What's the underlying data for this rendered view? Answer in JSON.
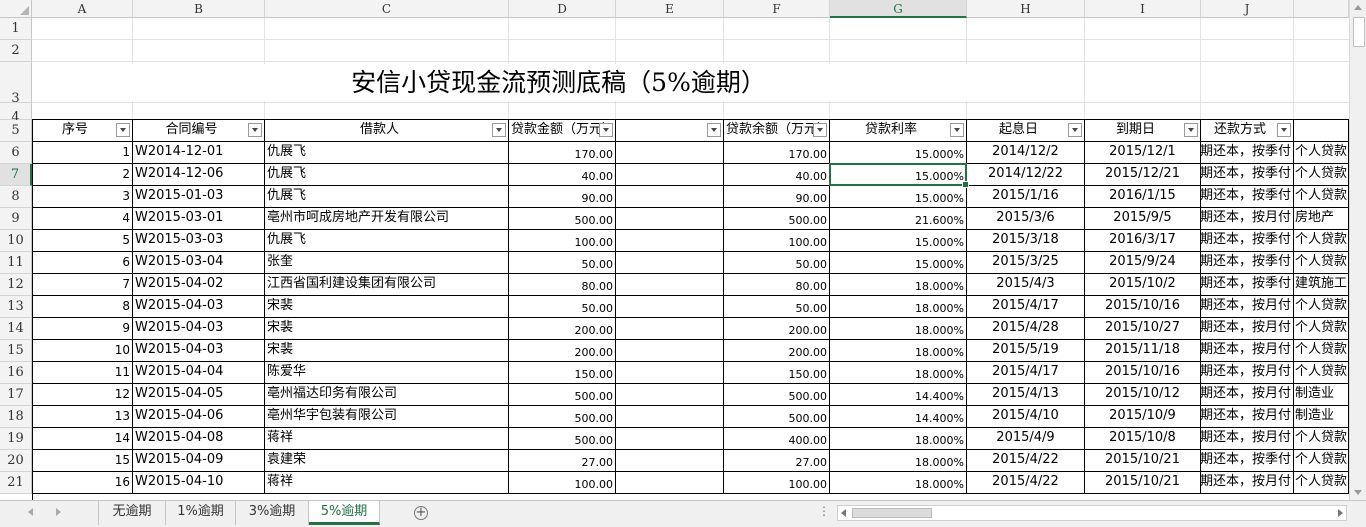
{
  "sheet": {
    "columns": [
      "A",
      "B",
      "C",
      "D",
      "E",
      "F",
      "G",
      "H",
      "I",
      "J"
    ],
    "selected_column": "G",
    "selected_row": 7,
    "row_numbers": [
      "1",
      "2",
      "3",
      "4",
      "5",
      "6",
      "7",
      "8",
      "9",
      "10",
      "11",
      "12",
      "13",
      "14",
      "15",
      "16",
      "17",
      "18",
      "19",
      "20",
      "21"
    ],
    "title": "安信小贷现金流预测底稿（5%逾期）",
    "headers": [
      "序号",
      "合同编号",
      "借款人",
      "贷款金额（万元）",
      "",
      "贷款余额（万元）",
      "贷款利率",
      "起息日",
      "到期日",
      "还款方式",
      ""
    ],
    "rows": [
      [
        "1",
        "W2014-12-01",
        "仇展飞",
        "170.00",
        "",
        "170.00",
        "15.000%",
        "2014/12/2",
        "2015/12/1",
        "期还本，按季付",
        "个人贷款"
      ],
      [
        "2",
        "W2014-12-06",
        "仇展飞",
        "40.00",
        "",
        "40.00",
        "15.000%",
        "2014/12/22",
        "2015/12/21",
        "期还本，按季付",
        "个人贷款"
      ],
      [
        "3",
        "W2015-01-03",
        "仇展飞",
        "90.00",
        "",
        "90.00",
        "15.000%",
        "2015/1/16",
        "2016/1/15",
        "期还本，按季付",
        "个人贷款"
      ],
      [
        "4",
        "W2015-03-01",
        "亳州市呵成房地产开发有限公司",
        "500.00",
        "",
        "500.00",
        "21.600%",
        "2015/3/6",
        "2015/9/5",
        "期还本，按月付",
        "房地产"
      ],
      [
        "5",
        "W2015-03-03",
        "仇展飞",
        "100.00",
        "",
        "100.00",
        "15.000%",
        "2015/3/18",
        "2016/3/17",
        "期还本，按季付",
        "个人贷款"
      ],
      [
        "6",
        "W2015-03-04",
        "张奎",
        "50.00",
        "",
        "50.00",
        "15.000%",
        "2015/3/25",
        "2015/9/24",
        "期还本，按季付",
        "个人贷款"
      ],
      [
        "7",
        "W2015-04-02",
        "江西省国利建设集团有限公司",
        "80.00",
        "",
        "80.00",
        "18.000%",
        "2015/4/3",
        "2015/10/2",
        "期还本，按季付",
        "建筑施工"
      ],
      [
        "8",
        "W2015-04-03",
        "宋裴",
        "50.00",
        "",
        "50.00",
        "18.000%",
        "2015/4/17",
        "2015/10/16",
        "期还本，按月付",
        "个人贷款"
      ],
      [
        "9",
        "W2015-04-03",
        "宋裴",
        "200.00",
        "",
        "200.00",
        "18.000%",
        "2015/4/28",
        "2015/10/27",
        "期还本，按月付",
        "个人贷款"
      ],
      [
        "10",
        "W2015-04-03",
        "宋裴",
        "200.00",
        "",
        "200.00",
        "18.000%",
        "2015/5/19",
        "2015/11/18",
        "期还本，按月付",
        "个人贷款"
      ],
      [
        "11",
        "W2015-04-04",
        "陈爱华",
        "150.00",
        "",
        "150.00",
        "18.000%",
        "2015/4/17",
        "2015/10/16",
        "期还本，按月付",
        "个人贷款"
      ],
      [
        "12",
        "W2015-04-05",
        " 亳州福达印务有限公司",
        "500.00",
        "",
        "500.00",
        "14.400%",
        "2015/4/13",
        "2015/10/12",
        "期还本，按月付",
        "制造业"
      ],
      [
        "13",
        "W2015-04-06",
        "亳州华宇包装有限公司",
        "500.00",
        "",
        "500.00",
        "14.400%",
        "2015/4/10",
        "2015/10/9",
        "期还本，按月付",
        "制造业"
      ],
      [
        "14",
        "W2015-04-08",
        "蒋祥",
        "500.00",
        "",
        "400.00",
        "18.000%",
        "2015/4/9",
        "2015/10/8",
        "期还本，按月付",
        "个人贷款"
      ],
      [
        "15",
        "W2015-04-09",
        "袁建荣",
        "27.00",
        "",
        "27.00",
        "18.000%",
        "2015/4/22",
        "2015/10/21",
        "期还本，按季付",
        "个人贷款"
      ],
      [
        "16",
        "W2015-04-10",
        "蒋祥",
        "100.00",
        "",
        "100.00",
        "18.000%",
        "2015/4/22",
        "2015/10/21",
        "期还本，按月付",
        "个人贷款"
      ]
    ]
  },
  "tabs": [
    "无逾期",
    "1%逾期",
    "3%逾期",
    "5%逾期"
  ],
  "active_tab": "5%逾期",
  "accent_color": "#217346"
}
